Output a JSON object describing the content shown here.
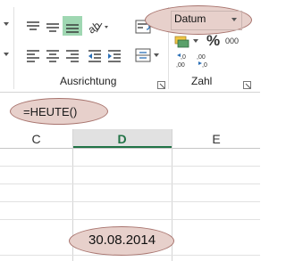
{
  "ribbon": {
    "group_alignment_label": "Ausrichtung",
    "group_number_label": "Zahl",
    "number_format_value": "Datum",
    "percent_symbol": "%",
    "thousands_symbol": "000",
    "increase_decimal_label": ",0\n,00",
    "decrease_decimal_label": ",00\n,0",
    "highlight_color": "#9fd7b2"
  },
  "formula_bar": {
    "formula": "=HEUTE()"
  },
  "sheet": {
    "columns": [
      "C",
      "D",
      "E"
    ],
    "active_column": "D",
    "active_color": "#217346",
    "cell_value": "30.08.2014"
  },
  "annotation_color": "#e7d0cb"
}
